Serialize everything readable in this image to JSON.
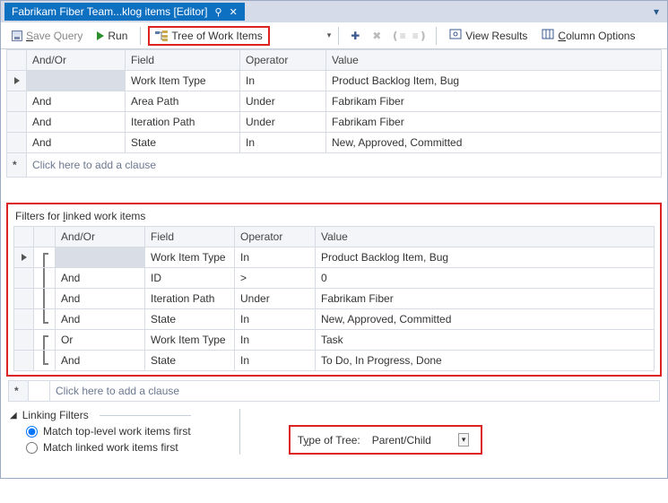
{
  "tab": {
    "title": "Fabrikam Fiber Team...klog items [Editor]"
  },
  "toolbar": {
    "save": "Save Query",
    "run": "Run",
    "tree_mode": "Tree of Work Items",
    "view_results": "View Results",
    "column_options": "Column Options"
  },
  "grid_headers": {
    "andor": "And/Or",
    "field": "Field",
    "operator": "Operator",
    "value": "Value"
  },
  "top_clauses": [
    {
      "andor": "",
      "field": "Work Item Type",
      "operator": "In",
      "value": "Product Backlog Item, Bug"
    },
    {
      "andor": "And",
      "field": "Area Path",
      "operator": "Under",
      "value": "Fabrikam Fiber"
    },
    {
      "andor": "And",
      "field": "Iteration Path",
      "operator": "Under",
      "value": "Fabrikam Fiber"
    },
    {
      "andor": "And",
      "field": "State",
      "operator": "In",
      "value": "New, Approved, Committed"
    }
  ],
  "add_clause_hint": "Click here to add a clause",
  "linked_section_title": "Filters for linked work items",
  "linked_clauses": [
    {
      "andor": "",
      "field": "Work Item Type",
      "operator": "In",
      "value": "Product Backlog Item, Bug"
    },
    {
      "andor": "And",
      "field": "ID",
      "operator": ">",
      "value": "0"
    },
    {
      "andor": "And",
      "field": "Iteration Path",
      "operator": "Under",
      "value": "Fabrikam Fiber"
    },
    {
      "andor": "And",
      "field": "State",
      "operator": "In",
      "value": "New, Approved, Committed"
    },
    {
      "andor": "Or",
      "field": "Work Item Type",
      "operator": "In",
      "value": "Task"
    },
    {
      "andor": "And",
      "field": "State",
      "operator": "In",
      "value": "To Do, In Progress, Done"
    }
  ],
  "linking": {
    "title": "Linking Filters",
    "radio_top": "Match top-level work items first",
    "radio_linked": "Match linked work items first",
    "type_label": "Type of Tree:",
    "type_value": "Parent/Child"
  }
}
